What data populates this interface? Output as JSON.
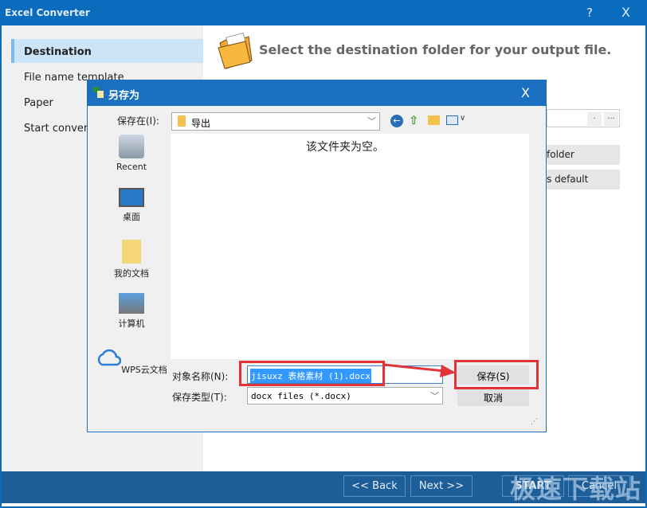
{
  "window": {
    "title": "Excel Converter",
    "help": "?",
    "close": "X"
  },
  "sidebar": {
    "items": [
      {
        "label": "Destination",
        "active": true
      },
      {
        "label": "File name template"
      },
      {
        "label": "Paper"
      },
      {
        "label": "Start conversi"
      }
    ]
  },
  "main": {
    "heading": "Select the destination folder for your output file.",
    "path_btn1": ".",
    "path_btn2": "...",
    "btn_folder": "folder",
    "btn_default": "s default"
  },
  "footer": {
    "back": "<< Back",
    "next": "Next >>",
    "start": "START",
    "cancel": "Cancel",
    "watermark": "极速下载站"
  },
  "dialog": {
    "title": "另存为",
    "close": "X",
    "save_in_label": "保存在(I):",
    "save_in_value": "导出",
    "empty_msg": "该文件夹为空。",
    "places": [
      {
        "label": "Recent",
        "icon": "recent-icon"
      },
      {
        "label": "桌面",
        "icon": "desktop-icon"
      },
      {
        "label": "我的文档",
        "icon": "documents-icon"
      },
      {
        "label": "计算机",
        "icon": "computer-icon"
      },
      {
        "label": "WPS云文档",
        "icon": "cloud-icon"
      }
    ],
    "filename_label": "对象名称(N):",
    "filename_value": "jisuxz 表格素材 (1).docx",
    "filetype_label": "保存类型(T):",
    "filetype_value": "docx files (*.docx)",
    "save": "保存(S)",
    "cancel": "取消"
  },
  "colors": {
    "titlebar": "#0a6cbc",
    "footer": "#1d5e98",
    "highlight": "#e0333a",
    "selection": "#3399ff"
  }
}
